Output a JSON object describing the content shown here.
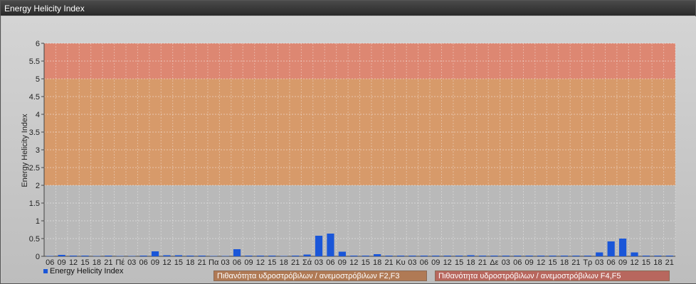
{
  "window": {
    "title": "Energy Helicity Index"
  },
  "legend": {
    "series_label": "Energy Helicity Index",
    "prob_f2f3": "Πιθανότητα υδροστρόβιλων / ανεμοστρόβιλων F2,F3",
    "prob_f4f5": "Πιθανότητα υδροστρόβιλων / ανεμοστρόβιλων F4,F5"
  },
  "colors": {
    "bar": "#1a56d8",
    "band_low": "#b9b9b9",
    "band_mid": "#d79a6a",
    "band_high": "#dd8772",
    "prob_f2f3_box": "#b07a55",
    "prob_f4f5_box": "#b8675e"
  },
  "chart_data": {
    "type": "bar",
    "title": "",
    "xlabel": "",
    "ylabel": "Energy Helicity Index",
    "ylim": [
      0,
      6
    ],
    "yticks": [
      "0",
      "0.5",
      "1",
      "1.5",
      "2",
      "2.5",
      "3",
      "3.5",
      "4",
      "4.5",
      "5",
      "5.5",
      "6"
    ],
    "grid": true,
    "legend_position": "bottom-left",
    "bands": [
      {
        "from": 0,
        "to": 2,
        "color": "#b9b9b9"
      },
      {
        "from": 2,
        "to": 5,
        "color": "#d79a6a"
      },
      {
        "from": 5,
        "to": 6,
        "color": "#dd8772"
      }
    ],
    "categories": [
      "06",
      "09",
      "12",
      "15",
      "18",
      "21",
      "Πέ",
      "03",
      "06",
      "09",
      "12",
      "15",
      "18",
      "21",
      "Πα",
      "03",
      "06",
      "09",
      "12",
      "15",
      "18",
      "21",
      "Σά",
      "03",
      "06",
      "09",
      "12",
      "15",
      "18",
      "21",
      "Κυ",
      "03",
      "06",
      "09",
      "12",
      "15",
      "18",
      "21",
      "Δε",
      "03",
      "06",
      "09",
      "12",
      "15",
      "18",
      "21",
      "Τρ",
      "03",
      "06",
      "09",
      "12",
      "15",
      "18",
      "21"
    ],
    "series": [
      {
        "values": [
          0.01,
          0.04,
          0.02,
          0.02,
          0.01,
          0.02,
          0.01,
          0.01,
          0.02,
          0.14,
          0.03,
          0.03,
          0.02,
          0.02,
          0.01,
          0.01,
          0.2,
          0.02,
          0.02,
          0.02,
          0.01,
          0.02,
          0.05,
          0.58,
          0.64,
          0.13,
          0.02,
          0.02,
          0.06,
          0.02,
          0.02,
          0.02,
          0.02,
          0.02,
          0.02,
          0.02,
          0.03,
          0.02,
          0.02,
          0.02,
          0.02,
          0.02,
          0.02,
          0.02,
          0.02,
          0.02,
          0.02,
          0.11,
          0.42,
          0.5,
          0.11,
          0.02,
          0.02,
          0.02
        ]
      }
    ]
  }
}
